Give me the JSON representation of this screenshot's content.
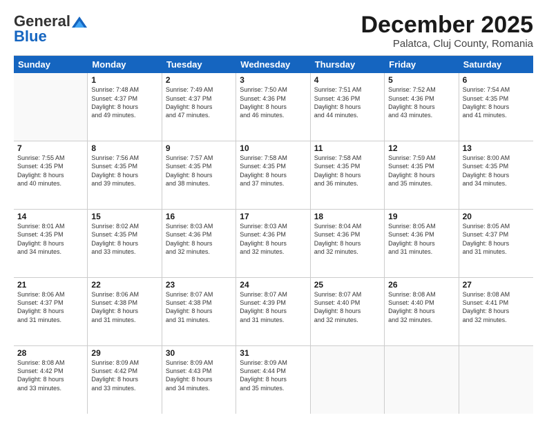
{
  "header": {
    "logo_general": "General",
    "logo_blue": "Blue",
    "month": "December 2025",
    "location": "Palatca, Cluj County, Romania"
  },
  "weekdays": [
    "Sunday",
    "Monday",
    "Tuesday",
    "Wednesday",
    "Thursday",
    "Friday",
    "Saturday"
  ],
  "rows": [
    [
      {
        "day": "",
        "info": ""
      },
      {
        "day": "1",
        "info": "Sunrise: 7:48 AM\nSunset: 4:37 PM\nDaylight: 8 hours\nand 49 minutes."
      },
      {
        "day": "2",
        "info": "Sunrise: 7:49 AM\nSunset: 4:37 PM\nDaylight: 8 hours\nand 47 minutes."
      },
      {
        "day": "3",
        "info": "Sunrise: 7:50 AM\nSunset: 4:36 PM\nDaylight: 8 hours\nand 46 minutes."
      },
      {
        "day": "4",
        "info": "Sunrise: 7:51 AM\nSunset: 4:36 PM\nDaylight: 8 hours\nand 44 minutes."
      },
      {
        "day": "5",
        "info": "Sunrise: 7:52 AM\nSunset: 4:36 PM\nDaylight: 8 hours\nand 43 minutes."
      },
      {
        "day": "6",
        "info": "Sunrise: 7:54 AM\nSunset: 4:35 PM\nDaylight: 8 hours\nand 41 minutes."
      }
    ],
    [
      {
        "day": "7",
        "info": "Sunrise: 7:55 AM\nSunset: 4:35 PM\nDaylight: 8 hours\nand 40 minutes."
      },
      {
        "day": "8",
        "info": "Sunrise: 7:56 AM\nSunset: 4:35 PM\nDaylight: 8 hours\nand 39 minutes."
      },
      {
        "day": "9",
        "info": "Sunrise: 7:57 AM\nSunset: 4:35 PM\nDaylight: 8 hours\nand 38 minutes."
      },
      {
        "day": "10",
        "info": "Sunrise: 7:58 AM\nSunset: 4:35 PM\nDaylight: 8 hours\nand 37 minutes."
      },
      {
        "day": "11",
        "info": "Sunrise: 7:58 AM\nSunset: 4:35 PM\nDaylight: 8 hours\nand 36 minutes."
      },
      {
        "day": "12",
        "info": "Sunrise: 7:59 AM\nSunset: 4:35 PM\nDaylight: 8 hours\nand 35 minutes."
      },
      {
        "day": "13",
        "info": "Sunrise: 8:00 AM\nSunset: 4:35 PM\nDaylight: 8 hours\nand 34 minutes."
      }
    ],
    [
      {
        "day": "14",
        "info": "Sunrise: 8:01 AM\nSunset: 4:35 PM\nDaylight: 8 hours\nand 34 minutes."
      },
      {
        "day": "15",
        "info": "Sunrise: 8:02 AM\nSunset: 4:35 PM\nDaylight: 8 hours\nand 33 minutes."
      },
      {
        "day": "16",
        "info": "Sunrise: 8:03 AM\nSunset: 4:36 PM\nDaylight: 8 hours\nand 32 minutes."
      },
      {
        "day": "17",
        "info": "Sunrise: 8:03 AM\nSunset: 4:36 PM\nDaylight: 8 hours\nand 32 minutes."
      },
      {
        "day": "18",
        "info": "Sunrise: 8:04 AM\nSunset: 4:36 PM\nDaylight: 8 hours\nand 32 minutes."
      },
      {
        "day": "19",
        "info": "Sunrise: 8:05 AM\nSunset: 4:36 PM\nDaylight: 8 hours\nand 31 minutes."
      },
      {
        "day": "20",
        "info": "Sunrise: 8:05 AM\nSunset: 4:37 PM\nDaylight: 8 hours\nand 31 minutes."
      }
    ],
    [
      {
        "day": "21",
        "info": "Sunrise: 8:06 AM\nSunset: 4:37 PM\nDaylight: 8 hours\nand 31 minutes."
      },
      {
        "day": "22",
        "info": "Sunrise: 8:06 AM\nSunset: 4:38 PM\nDaylight: 8 hours\nand 31 minutes."
      },
      {
        "day": "23",
        "info": "Sunrise: 8:07 AM\nSunset: 4:38 PM\nDaylight: 8 hours\nand 31 minutes."
      },
      {
        "day": "24",
        "info": "Sunrise: 8:07 AM\nSunset: 4:39 PM\nDaylight: 8 hours\nand 31 minutes."
      },
      {
        "day": "25",
        "info": "Sunrise: 8:07 AM\nSunset: 4:40 PM\nDaylight: 8 hours\nand 32 minutes."
      },
      {
        "day": "26",
        "info": "Sunrise: 8:08 AM\nSunset: 4:40 PM\nDaylight: 8 hours\nand 32 minutes."
      },
      {
        "day": "27",
        "info": "Sunrise: 8:08 AM\nSunset: 4:41 PM\nDaylight: 8 hours\nand 32 minutes."
      }
    ],
    [
      {
        "day": "28",
        "info": "Sunrise: 8:08 AM\nSunset: 4:42 PM\nDaylight: 8 hours\nand 33 minutes."
      },
      {
        "day": "29",
        "info": "Sunrise: 8:09 AM\nSunset: 4:42 PM\nDaylight: 8 hours\nand 33 minutes."
      },
      {
        "day": "30",
        "info": "Sunrise: 8:09 AM\nSunset: 4:43 PM\nDaylight: 8 hours\nand 34 minutes."
      },
      {
        "day": "31",
        "info": "Sunrise: 8:09 AM\nSunset: 4:44 PM\nDaylight: 8 hours\nand 35 minutes."
      },
      {
        "day": "",
        "info": ""
      },
      {
        "day": "",
        "info": ""
      },
      {
        "day": "",
        "info": ""
      }
    ]
  ]
}
